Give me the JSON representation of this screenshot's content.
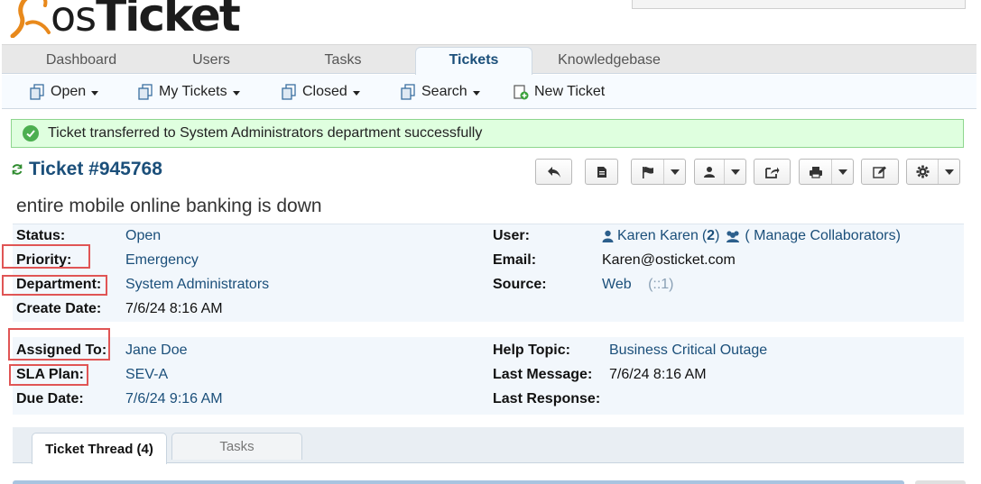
{
  "app": {
    "logo_text_os": "os",
    "logo_text_main": "Ticket"
  },
  "nav": {
    "tabs": [
      {
        "label": "Dashboard"
      },
      {
        "label": "Users"
      },
      {
        "label": "Tasks"
      },
      {
        "label": "Tickets",
        "active": true
      },
      {
        "label": "Knowledgebase"
      }
    ]
  },
  "subnav": {
    "items": [
      {
        "label": "Open",
        "icon": "ticket-queue-icon"
      },
      {
        "label": "My Tickets",
        "icon": "ticket-queue-icon"
      },
      {
        "label": "Closed",
        "icon": "ticket-queue-icon"
      },
      {
        "label": "Search",
        "icon": "ticket-queue-icon"
      },
      {
        "label": "New Ticket",
        "icon": "new-ticket-icon"
      }
    ]
  },
  "banner": {
    "message": "Ticket transferred to System Administrators department successfully",
    "icon": "success-check-icon"
  },
  "ticket": {
    "title": "Ticket #945768",
    "subject": "entire mobile online banking is down"
  },
  "toolbar": {
    "buttons": [
      "reply-icon",
      "note-icon",
      "flag-icon",
      "assign-icon",
      "transfer-icon",
      "print-icon",
      "edit-icon",
      "settings-icon"
    ]
  },
  "info": {
    "status_label": "Status:",
    "status_value": "Open",
    "priority_label": "Priority:",
    "priority_value": "Emergency",
    "department_label": "Department:",
    "department_value": "System Administrators",
    "create_date_label": "Create Date:",
    "create_date_value": "7/6/24 8:16 AM",
    "user_label": "User:",
    "user_name": "Karen Karen",
    "user_count_open": "(",
    "user_count": "2",
    "user_count_close": ")",
    "manage_collaborators": "( Manage Collaborators)",
    "email_label": "Email:",
    "email_value": "Karen@osticket.com",
    "source_label": "Source:",
    "source_value": "Web",
    "source_extra": "(::1)",
    "assigned_label": "Assigned To:",
    "assigned_value": "Jane Doe",
    "sla_label": "SLA Plan:",
    "sla_value": "SEV-A",
    "due_label": "Due Date:",
    "due_value": "7/6/24 9:16 AM",
    "help_topic_label": "Help Topic:",
    "help_topic_value": "Business Critical Outage",
    "last_message_label": "Last Message:",
    "last_message_value": "7/6/24 8:16 AM",
    "last_response_label": "Last Response:",
    "last_response_value": ""
  },
  "thread_tabs": [
    {
      "label": "Ticket Thread (4)",
      "active": true
    },
    {
      "label": "Tasks",
      "active": false
    }
  ],
  "colors": {
    "link": "#1b4f7a",
    "highlight_box": "#e05555",
    "banner_bg": "#dfffdf",
    "success": "#4caf50"
  }
}
